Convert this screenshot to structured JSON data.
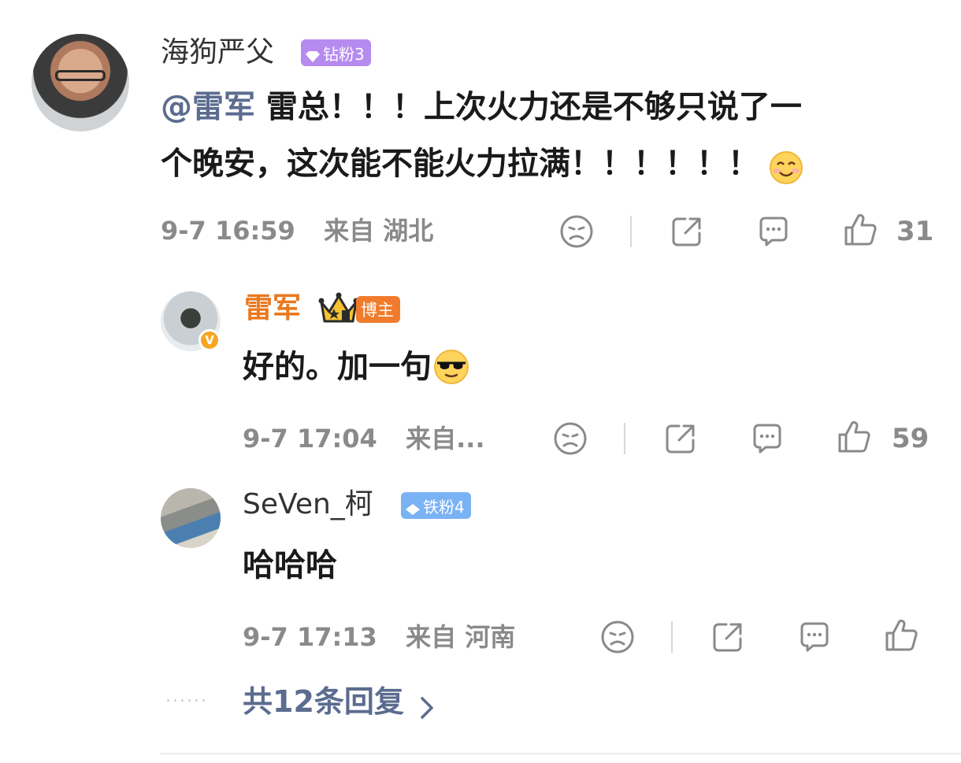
{
  "colors": {
    "link": "#5b6c8f",
    "blogger_name": "#e8791f",
    "meta_gray": "#8a8a8a",
    "badge_diamond": "#b68bf0",
    "badge_iron": "#7ab3f5",
    "badge_blogger": "#f07b2c"
  },
  "comment": {
    "username": "海狗严父",
    "badge": "钻粉3",
    "mention": "@雷军",
    "text_line1": " 雷总！！！上次火力还是不够只说了一",
    "text_line2": "个晚安，这次能不能火力拉满！！！！！！",
    "emoji": "smile-emoji",
    "time": "9-7 16:59",
    "location": "来自 湖北",
    "likes": "31",
    "icons": [
      "sad-face-icon",
      "share-icon",
      "comment-icon",
      "like-icon"
    ]
  },
  "replies": [
    {
      "username": "雷军",
      "badge": "博主",
      "text": "好的。加一句",
      "emoji": "sunglasses-emoji",
      "time": "9-7 17:04",
      "location": "来自...",
      "likes": "59"
    },
    {
      "username": "SeVen_柯",
      "badge": "铁粉4",
      "text": "哈哈哈",
      "time": "9-7 17:13",
      "location": "来自 河南",
      "likes": ""
    }
  ],
  "more_replies": {
    "dots": "......",
    "label": "共12条回复",
    "chevron": "chevron-right-icon"
  }
}
